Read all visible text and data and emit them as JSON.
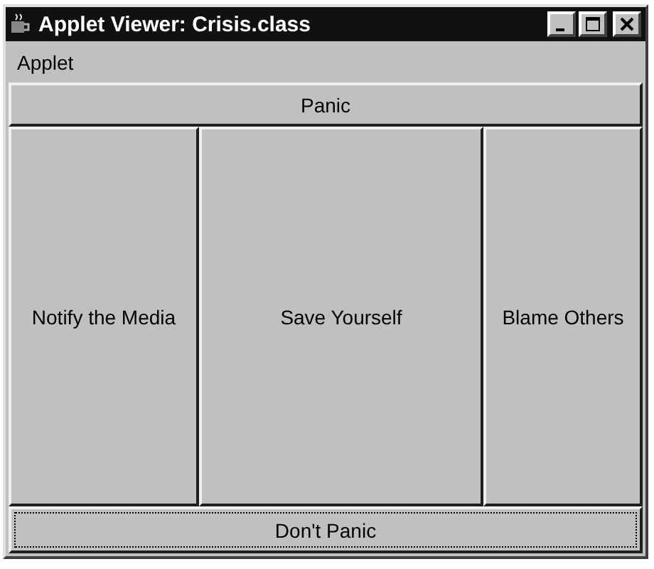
{
  "window": {
    "title": "Applet Viewer: Crisis.class"
  },
  "menu_bar": [
    "Applet"
  ],
  "buttons": [
    {
      "kind": "north",
      "label": "Panic",
      "focused": false
    },
    {
      "kind": "west",
      "label": "Notify the Media",
      "focused": false
    },
    {
      "kind": "center",
      "label": "Save Yourself",
      "focused": false
    },
    {
      "kind": "east",
      "label": "Blame Others",
      "focused": false
    },
    {
      "kind": "south",
      "label": "Don't Panic",
      "focused": true
    }
  ]
}
